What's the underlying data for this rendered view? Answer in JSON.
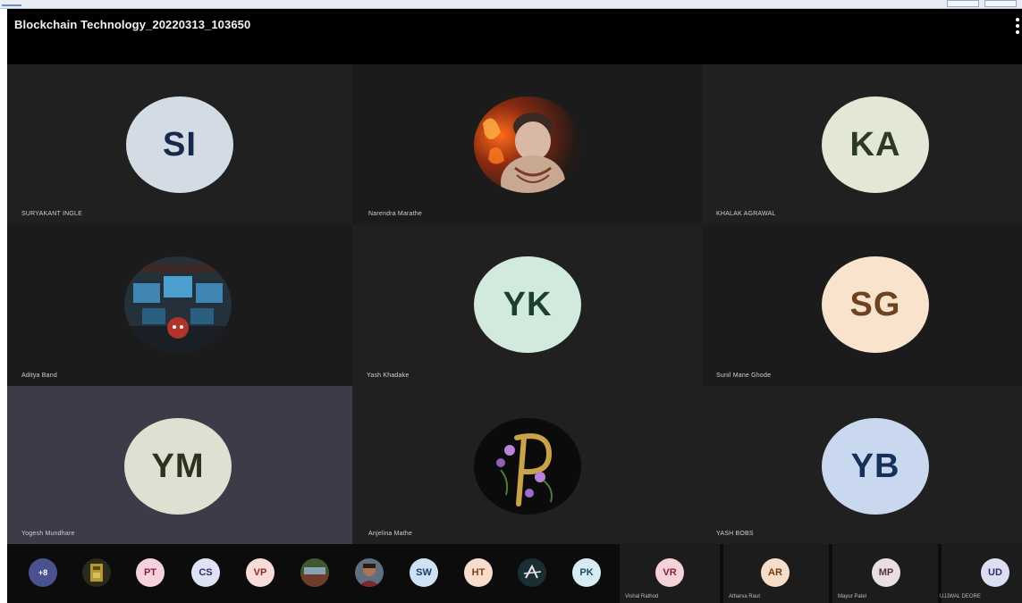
{
  "meeting": {
    "title": "Blockchain Technology_20220313_103650"
  },
  "tiles": [
    {
      "initials": "SI",
      "name": "SURYAKANT INGLE"
    },
    {
      "initials": "",
      "name": "Narendra Marathe"
    },
    {
      "initials": "KA",
      "name": "KHALAK AGRAWAL"
    },
    {
      "initials": "",
      "name": "Aditya Band"
    },
    {
      "initials": "YK",
      "name": "Yash Khadake"
    },
    {
      "initials": "SG",
      "name": "Sunil Mane Ghode"
    },
    {
      "initials": "YM",
      "name": "Yogesh Mundhare"
    },
    {
      "initials": "",
      "name": "Anjelina Mathe"
    },
    {
      "initials": "YB",
      "name": "YASH BOBS"
    }
  ],
  "bottom_bar": {
    "overflow_label": "+8",
    "avatars": [
      "",
      "PT",
      "CS",
      "VP",
      "",
      "",
      "SW",
      "HT",
      "",
      "PK"
    ],
    "tiles": [
      {
        "initials": "VR",
        "name": "Vishal Rathod"
      },
      {
        "initials": "AR",
        "name": "Atharva Raut"
      },
      {
        "initials": "MP",
        "name": "Mayur Patel"
      },
      {
        "initials": "UD",
        "name": "UJJWAL DEORE"
      }
    ]
  },
  "colors": {
    "tile_bg": "#202020",
    "tile_bg_alt": "#1b1b1b",
    "active_tile_bg": "#3c3c48",
    "title_bar": "#000000"
  }
}
